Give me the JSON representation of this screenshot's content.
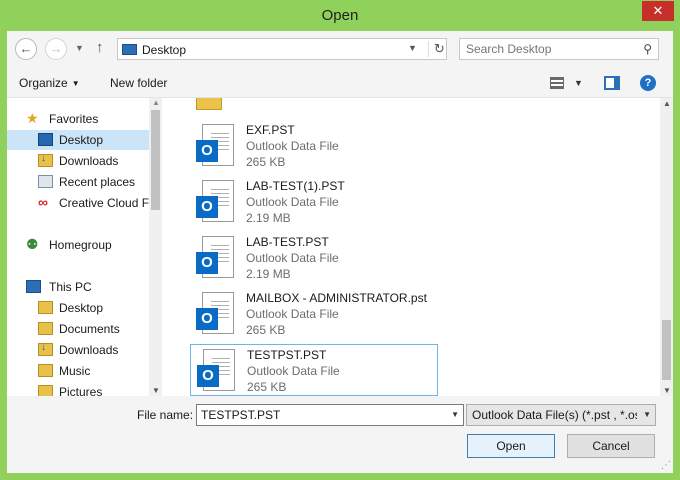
{
  "window": {
    "title": "Open",
    "close_label": "✕"
  },
  "address_bar": {
    "location": "Desktop"
  },
  "search": {
    "placeholder": "Search Desktop"
  },
  "toolbar": {
    "organize_label": "Organize",
    "new_folder_label": "New folder"
  },
  "nav_pane": {
    "items": [
      {
        "label": "Favorites",
        "icon": "star-icon"
      },
      {
        "label": "Desktop",
        "icon": "desktop-icon",
        "selected": true
      },
      {
        "label": "Downloads",
        "icon": "downloads-folder-icon"
      },
      {
        "label": "Recent places",
        "icon": "recent-places-icon"
      },
      {
        "label": "Creative Cloud Fi",
        "icon": "creative-cloud-icon"
      },
      {
        "label": "Homegroup",
        "icon": "homegroup-icon"
      },
      {
        "label": "This PC",
        "icon": "computer-icon"
      },
      {
        "label": "Desktop",
        "icon": "desktop-folder-icon"
      },
      {
        "label": "Documents",
        "icon": "documents-folder-icon"
      },
      {
        "label": "Downloads",
        "icon": "downloads-folder-icon"
      },
      {
        "label": "Music",
        "icon": "music-folder-icon"
      },
      {
        "label": "Pictures",
        "icon": "pictures-folder-icon"
      }
    ]
  },
  "files": [
    {
      "name": "EXF.PST",
      "type": "Outlook Data File",
      "size": "265 KB"
    },
    {
      "name": "LAB-TEST(1).PST",
      "type": "Outlook Data File",
      "size": "2.19 MB"
    },
    {
      "name": "LAB-TEST.PST",
      "type": "Outlook Data File",
      "size": "2.19 MB"
    },
    {
      "name": "MAILBOX - ADMINISTRATOR.pst",
      "type": "Outlook Data File",
      "size": "265 KB"
    },
    {
      "name": "TESTPST.PST",
      "type": "Outlook Data File",
      "size": "265 KB",
      "selected": true
    }
  ],
  "file_name_field": {
    "label": "File name:",
    "value": "TESTPST.PST"
  },
  "file_type_filter": {
    "value": "Outlook Data File(s) (*.pst , *.os"
  },
  "buttons": {
    "open_label": "Open",
    "cancel_label": "Cancel"
  },
  "icon_glyphs": {
    "outlook_badge": "O"
  },
  "colors": {
    "frame": "#8fd15b",
    "close": "#c7302a",
    "selection": "#cce4f7",
    "outlook_blue": "#0a6bc4"
  }
}
